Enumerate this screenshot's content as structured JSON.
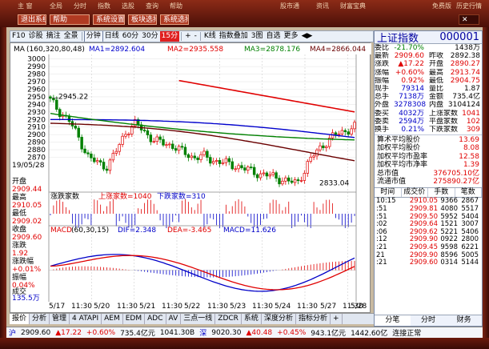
{
  "topbar": {
    "buttons": [
      "退出系统",
      "帮助",
      "系统设置",
      "板块选择",
      "系统选择",
      "设置选择"
    ],
    "texts": [
      "主  窗",
      "全局",
      "分时",
      "指数",
      "选股",
      "查询",
      "帮助",
      "股市通",
      "资讯",
      "财富宝典",
      "免费版",
      "历史行情"
    ]
  },
  "toolbar": [
    "F10",
    "诊股",
    "摘注",
    "全景",
    "分钟",
    "日线",
    "60分",
    "30分",
    "15分",
    "+",
    "-",
    "K线",
    "指数叠加",
    "3图",
    "自选",
    "更多"
  ],
  "legend": {
    "ma_label": "MA",
    "ma_params": "(160,320,80,48)",
    "ma1": "MA1=2892.604",
    "ma2": "MA2=2935.558",
    "ma3": "MA3=2878.176",
    "ma4": "MA4=2866.044"
  },
  "price_axis": [
    "3000",
    "2990",
    "2980",
    "2970",
    "2960",
    "2950",
    "2940",
    "2930",
    "2920",
    "2910",
    "2900",
    "2890",
    "2880",
    "2870"
  ],
  "annotations": {
    "high": "2945.22",
    "low": "2833.04"
  },
  "indicator1": {
    "name": "涨跌家数",
    "up": "上涨家数=1040",
    "down": "下跌家数=310"
  },
  "indicator2": {
    "name": "MACD",
    "params": "(60,30,15)",
    "dif": "DIF=2.348",
    "dea": "DEA=-3.465",
    "macd": "MACD=11.626"
  },
  "left_panel": [
    "19/05/28",
    "开盘",
    "2909.44",
    "最高",
    "2910.05",
    "最低",
    "2909.02",
    "收盘",
    "2909.60",
    "涨跌",
    "1.92",
    "涨跌幅",
    "+0.01%",
    "振幅",
    "0.04%",
    "成交",
    "135.5万",
    "金额",
    "13.38亿"
  ],
  "dates": [
    "5/17",
    "11:30",
    "5/20",
    "11:30",
    "5/21",
    "11:30",
    "5/22",
    "11:30",
    "5/23",
    "11:30",
    "5/24",
    "11:30",
    "5/27",
    "11:30",
    "5/28"
  ],
  "quote": {
    "name": "上证指数",
    "code": "000001",
    "rows1": [
      [
        "委比",
        "-21.70%",
        "",
        "1438万"
      ],
      [
        "最新",
        "2909.60",
        "昨收",
        "2892.38"
      ],
      [
        "涨跌",
        "▲17.22",
        "开盘",
        "2890.27"
      ],
      [
        "涨幅",
        "+0.60%",
        "最高",
        "2913.74"
      ],
      [
        "振幅",
        "0.92%",
        "最低",
        "2904.75"
      ],
      [
        "现手",
        "79314",
        "量比",
        "1.87"
      ],
      [
        "总手",
        "7138万",
        "金额",
        "735.4亿"
      ],
      [
        "外盘",
        "3278308",
        "内盘",
        "3104124"
      ],
      [
        "委买",
        "4032万",
        "上涨家数",
        "1041"
      ],
      [
        "委卖",
        "2594万",
        "平盘家数",
        "102"
      ],
      [
        "换手",
        "0.21%",
        "下跌家数",
        "309"
      ]
    ],
    "rows2": [
      [
        "算术平均股价",
        "13.69"
      ],
      [
        "加权平均股价",
        "8.08"
      ],
      [
        "加权平均市盈率",
        "12.58"
      ],
      [
        "加权平均市净率",
        "1.39"
      ],
      [
        "总市值",
        "376705.10亿"
      ],
      [
        "流通市值",
        "275890.27亿"
      ]
    ],
    "minitabs": [
      "时间",
      "成交价",
      "手数",
      "笔数"
    ],
    "ticks": [
      [
        "10:15",
        "2910.05",
        "9366",
        "2867"
      ],
      [
        ":51",
        "2909.81",
        "4080",
        "5517"
      ],
      [
        ":51",
        "2909.50",
        "5952",
        "5404"
      ],
      [
        ":02",
        "2909.64",
        "1521",
        "3007"
      ],
      [
        ":06",
        "2909.62",
        "5221",
        "5406"
      ],
      [
        ":12",
        "2909.90",
        "0922",
        "2800"
      ],
      [
        ":21",
        "2909.45",
        "9598",
        "6221"
      ],
      [
        "21",
        "2909.90",
        "8596",
        "5005"
      ],
      [
        ":21",
        "2909.60",
        "0314",
        "5144"
      ]
    ],
    "tabs": [
      "分笔",
      "分时",
      "财务"
    ]
  },
  "bottom_tabs": [
    "报价",
    "分析",
    "管理",
    "4 ATAPI",
    "AEM",
    "EDM",
    "ADC",
    "AV",
    "三点一线",
    "ZDCR",
    "系统",
    "深度分析",
    "指标分析",
    "+"
  ],
  "statusbar": [
    "沪",
    "2909.60",
    "▲17.22",
    "+0.60%",
    "735.4亿元",
    "1041.30B",
    "深",
    "9020.30",
    "▲40.48",
    "+0.45%",
    "943.1亿元",
    "1442.60亿",
    "连接正常"
  ],
  "colors": {
    "ma1": "#0000cc",
    "ma2": "#e00000",
    "ma3": "#008000",
    "ma4": "#6a0000",
    "up": "#e00000",
    "down": "#008000"
  }
}
